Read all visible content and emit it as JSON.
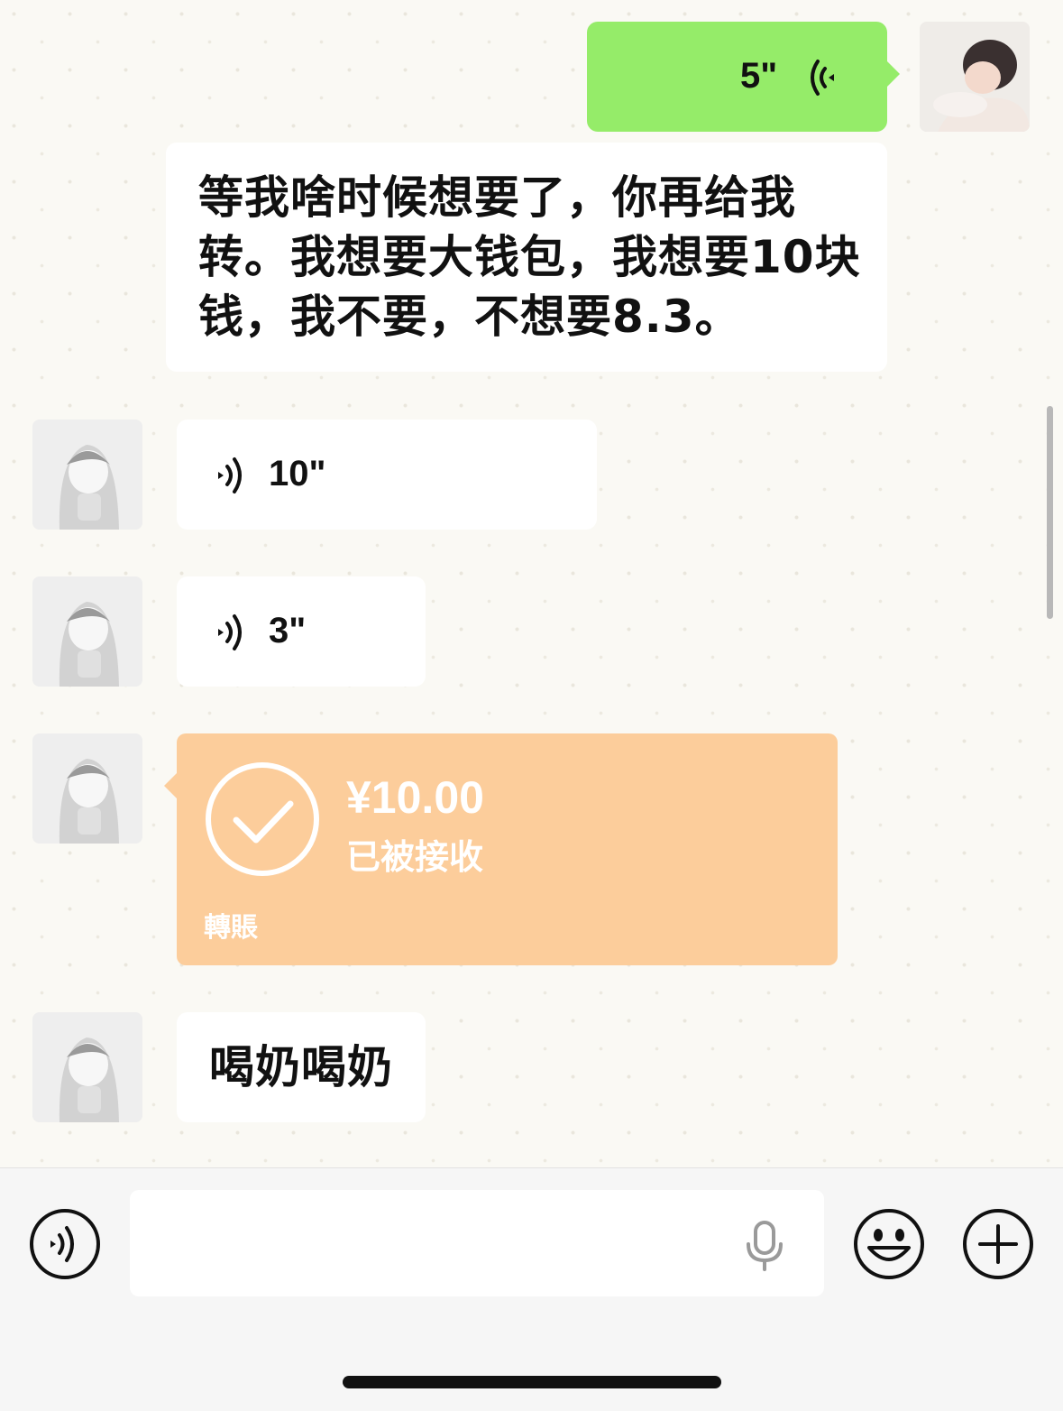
{
  "messages": {
    "outgoing_voice": {
      "duration": "5\""
    },
    "incoming_text_1": {
      "lines": [
        "等我啥时候想要了，你再给我",
        "转。我想要大钱包，我想要10块",
        "钱，我不要，不想要8.3。"
      ]
    },
    "incoming_voice_1": {
      "duration": "10\""
    },
    "incoming_voice_2": {
      "duration": "3\""
    },
    "transfer": {
      "amount": "¥10.00",
      "status": "已被接收",
      "label": "轉賬"
    },
    "incoming_text_2": {
      "text": "喝奶喝奶"
    }
  },
  "input_bar": {
    "text_value": "",
    "icons": [
      "voice-mode-icon",
      "microphone-icon",
      "emoji-icon",
      "plus-icon"
    ]
  },
  "colors": {
    "outgoing_bubble": "#95ec69",
    "incoming_bubble": "#ffffff",
    "transfer_card": "#fccd9b",
    "background": "#faf9f4"
  }
}
